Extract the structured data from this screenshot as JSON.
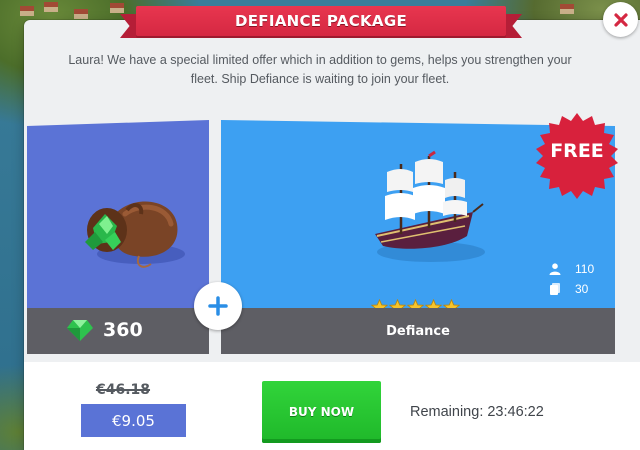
{
  "modal": {
    "title": "DEFIANCE PACKAGE",
    "description": "Laura! We have a special limited offer which in addition to gems, helps you strengthen your fleet. Ship Defiance is waiting to join your fleet.",
    "close_icon": "close-icon"
  },
  "gems_card": {
    "icon": "gem-bag-icon",
    "count": "360",
    "count_icon": "gem-icon"
  },
  "ship_card": {
    "badge": "FREE",
    "name": "Defiance",
    "stars": 5,
    "crew": "110",
    "crew_icon": "crew-icon",
    "cargo": "30",
    "cargo_icon": "cargo-icon"
  },
  "connector_icon": "plus-icon",
  "purchase": {
    "old_price": "€46.18",
    "price": "€9.05",
    "buy_label": "BUY NOW",
    "remaining": "Remaining: 23:46:22"
  },
  "colors": {
    "ribbon": "#d52842",
    "gems_card_bg": "#5b73d6",
    "ship_card_bg": "#3da0f2",
    "buy_button": "#23be2e",
    "price_box": "#5a73d6",
    "free_badge": "#d8213c",
    "card_footer": "#5e5e64"
  }
}
